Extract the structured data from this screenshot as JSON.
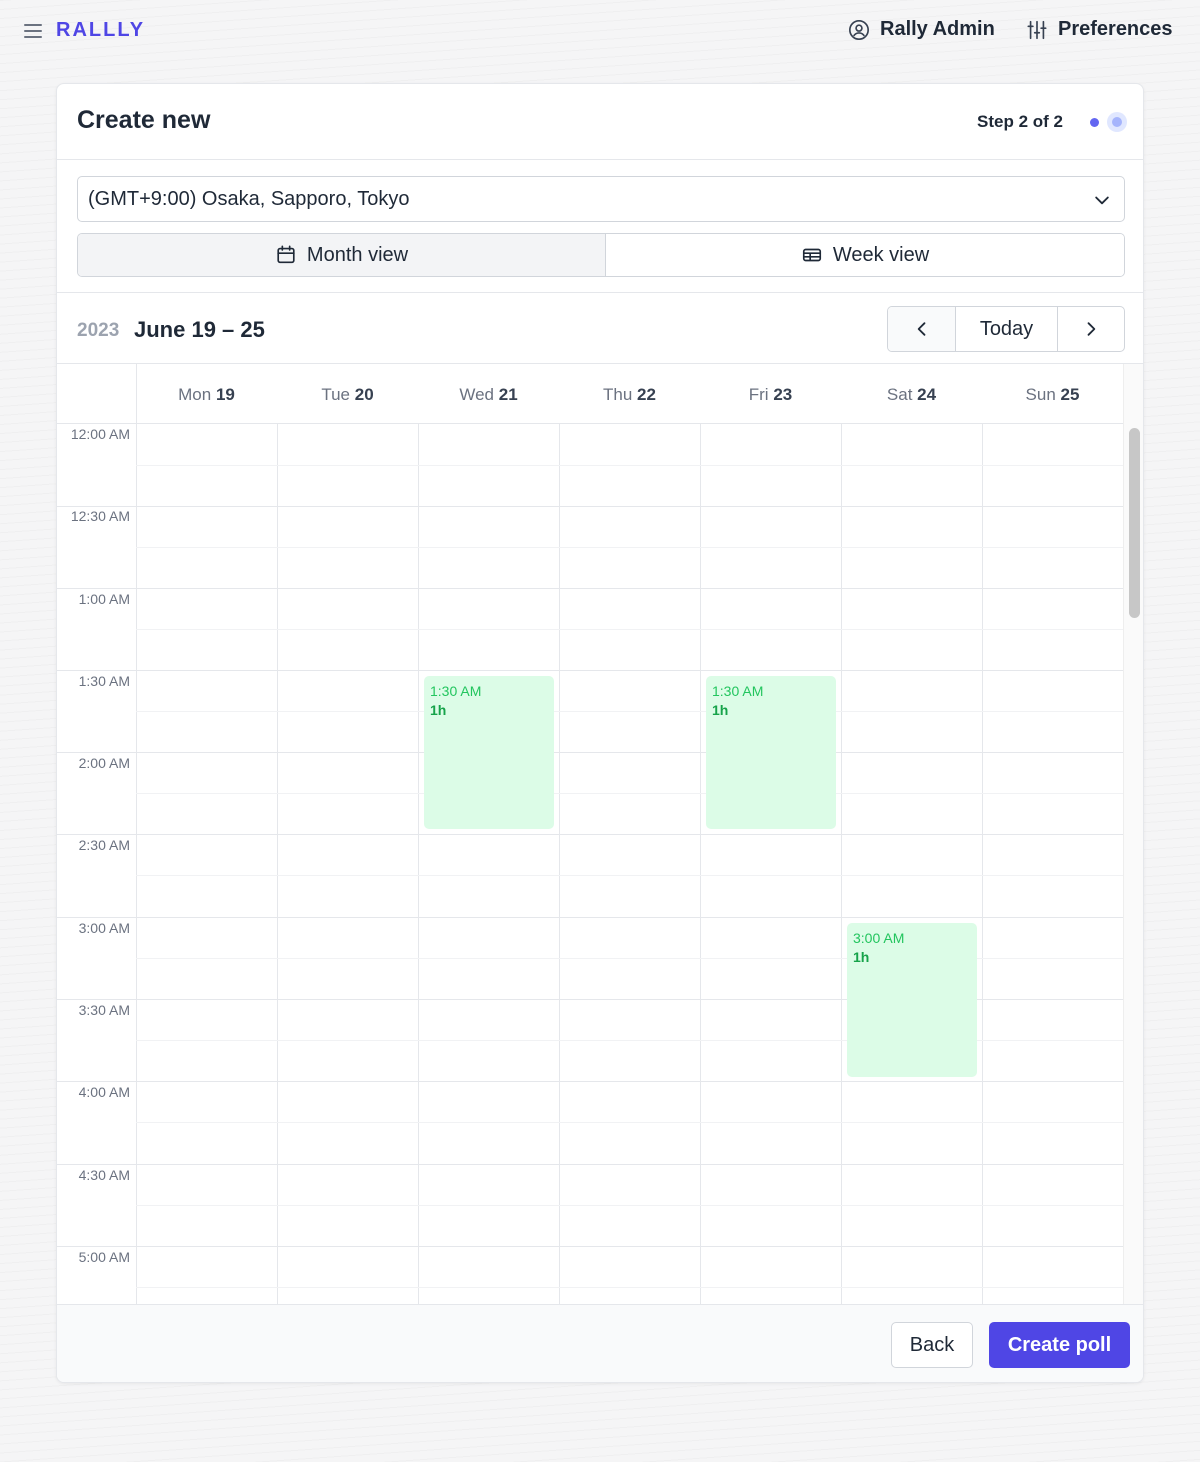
{
  "app": {
    "logo": "RALLLY"
  },
  "header": {
    "menu_icon": "menu-icon",
    "user_label": "Rally Admin",
    "user_icon": "user-circle-icon",
    "preferences_label": "Preferences",
    "preferences_icon": "sliders-icon"
  },
  "card": {
    "title": "Create new",
    "step_text": "Step 2 of 2"
  },
  "timezone": {
    "value": "(GMT+9:00) Osaka, Sapporo, Tokyo"
  },
  "views": {
    "month_label": "Month view",
    "week_label": "Week view",
    "active": "month"
  },
  "calendar": {
    "year": "2023",
    "range": "June 19 – 25",
    "today_label": "Today",
    "days": [
      {
        "name": "Mon",
        "num": "19"
      },
      {
        "name": "Tue",
        "num": "20"
      },
      {
        "name": "Wed",
        "num": "21"
      },
      {
        "name": "Thu",
        "num": "22"
      },
      {
        "name": "Fri",
        "num": "23"
      },
      {
        "name": "Sat",
        "num": "24"
      },
      {
        "name": "Sun",
        "num": "25"
      }
    ],
    "times": [
      "12:00 AM",
      "12:30 AM",
      "1:00 AM",
      "1:30 AM",
      "2:00 AM",
      "2:30 AM",
      "3:00 AM",
      "3:30 AM",
      "4:00 AM",
      "4:30 AM",
      "5:00 AM"
    ],
    "events": [
      {
        "day": "Wed 21",
        "time": "1:30 AM",
        "duration": "1h"
      },
      {
        "day": "Fri 23",
        "time": "1:30 AM",
        "duration": "1h"
      },
      {
        "day": "Sat 24",
        "time": "3:00 AM",
        "duration": "1h"
      }
    ]
  },
  "footer": {
    "back_label": "Back",
    "create_label": "Create poll"
  },
  "colors": {
    "accent": "#4f46e5",
    "event_bg": "#dcfce7",
    "event_text": "#16a34a"
  }
}
